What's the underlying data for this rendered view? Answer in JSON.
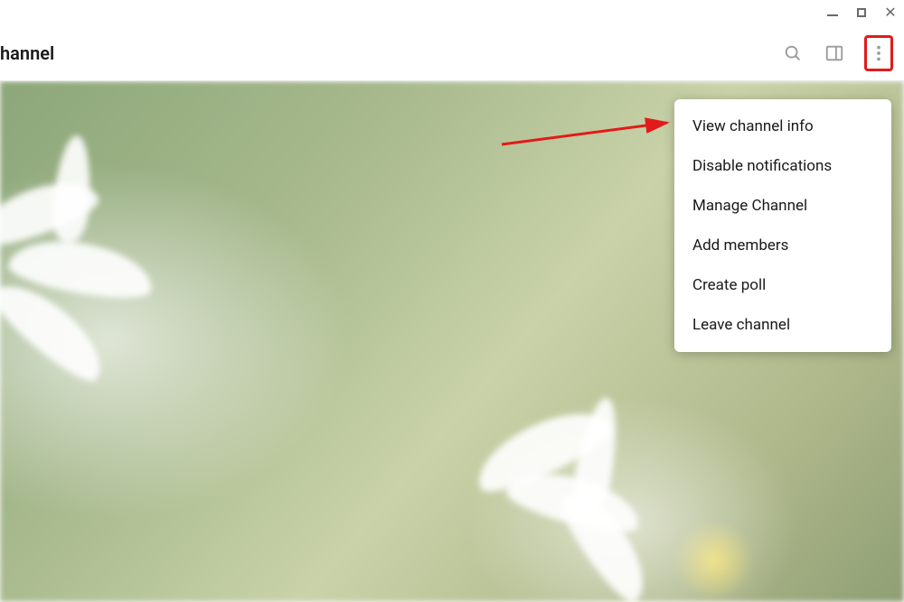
{
  "header": {
    "title": "hannel"
  },
  "menu": {
    "items": [
      {
        "label": "View channel info"
      },
      {
        "label": "Disable notifications"
      },
      {
        "label": "Manage Channel"
      },
      {
        "label": "Add members"
      },
      {
        "label": "Create poll"
      },
      {
        "label": "Leave channel"
      }
    ]
  },
  "annotation": {
    "highlight_color": "#e11b1b"
  }
}
